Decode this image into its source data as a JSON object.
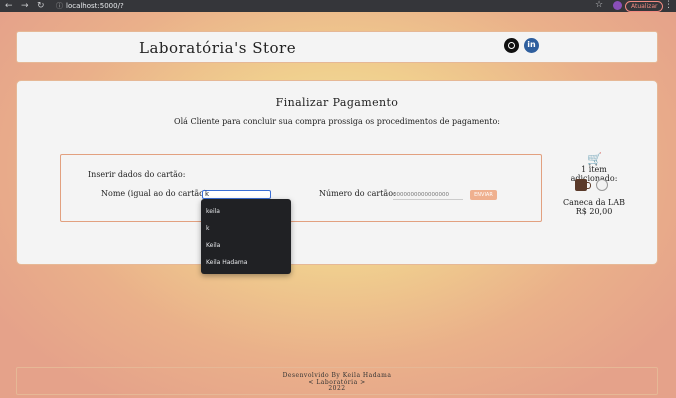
{
  "browser": {
    "url": "localhost:5000/?",
    "update_label": "Atualizar"
  },
  "header": {
    "title": "Laboratória's Store"
  },
  "checkout": {
    "title": "Finalizar Pagamento",
    "subtitle": "Olá Cliente para concluir sua compra prossiga os procedimentos de pagamento:",
    "card_heading": "Inserir dados do cartão:",
    "name_label": "Nome (igual ao do cartão):",
    "name_value": "k",
    "number_label": "Número do cartão:",
    "number_placeholder": "0000000000000000",
    "send_label": "ENVIAR"
  },
  "cart": {
    "count_label": "1 item adicionado:",
    "product_name": "Caneca da LAB",
    "product_price": "R$ 20,00"
  },
  "autocomplete": {
    "options": [
      "keila",
      "k",
      "Keila",
      "Keila Hadama"
    ]
  },
  "footer": {
    "line1": "Desenvolvido By Keila Hadama",
    "line2": "< Laboratória >",
    "line3": "2022"
  },
  "colors": {
    "accent": "#efb08f",
    "border": "#e6b896",
    "linkedin": "#2f5f9e",
    "update": "#f28b82"
  }
}
